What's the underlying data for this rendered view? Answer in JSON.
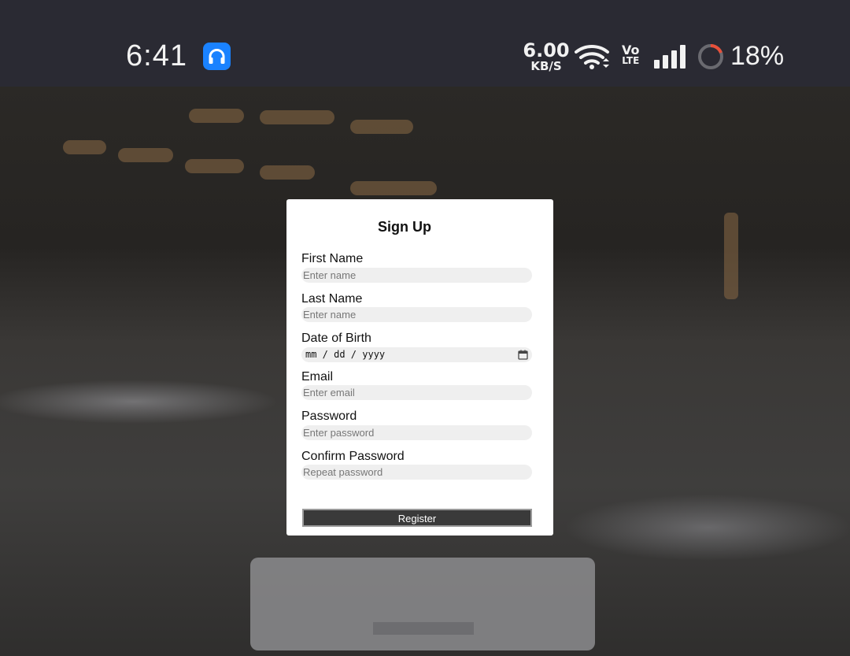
{
  "status_bar": {
    "time": "6:41",
    "notification_icon": "headset-icon",
    "net_speed_value": "6.00",
    "net_speed_unit": "KB/S",
    "volte_top": "Vo",
    "volte_bottom": "LTE",
    "battery_percent": "18%",
    "battery_level": 0.18
  },
  "form": {
    "title": "Sign Up",
    "fields": [
      {
        "label": "First Name",
        "placeholder": "Enter name"
      },
      {
        "label": "Last Name",
        "placeholder": "Enter name"
      },
      {
        "label": "Date of Birth",
        "value": "mm / dd / yyyy"
      },
      {
        "label": "Email",
        "placeholder": "Enter email"
      },
      {
        "label": "Password",
        "placeholder": "Enter password"
      },
      {
        "label": "Confirm Password",
        "placeholder": "Repeat password"
      }
    ],
    "register_label": "Register"
  },
  "colors": {
    "status_bar_bg": "#2a2a33",
    "headset_badge": "#1a82ff",
    "battery_ring_accent": "#e8503a",
    "button_bg": "#3a3a3a"
  }
}
